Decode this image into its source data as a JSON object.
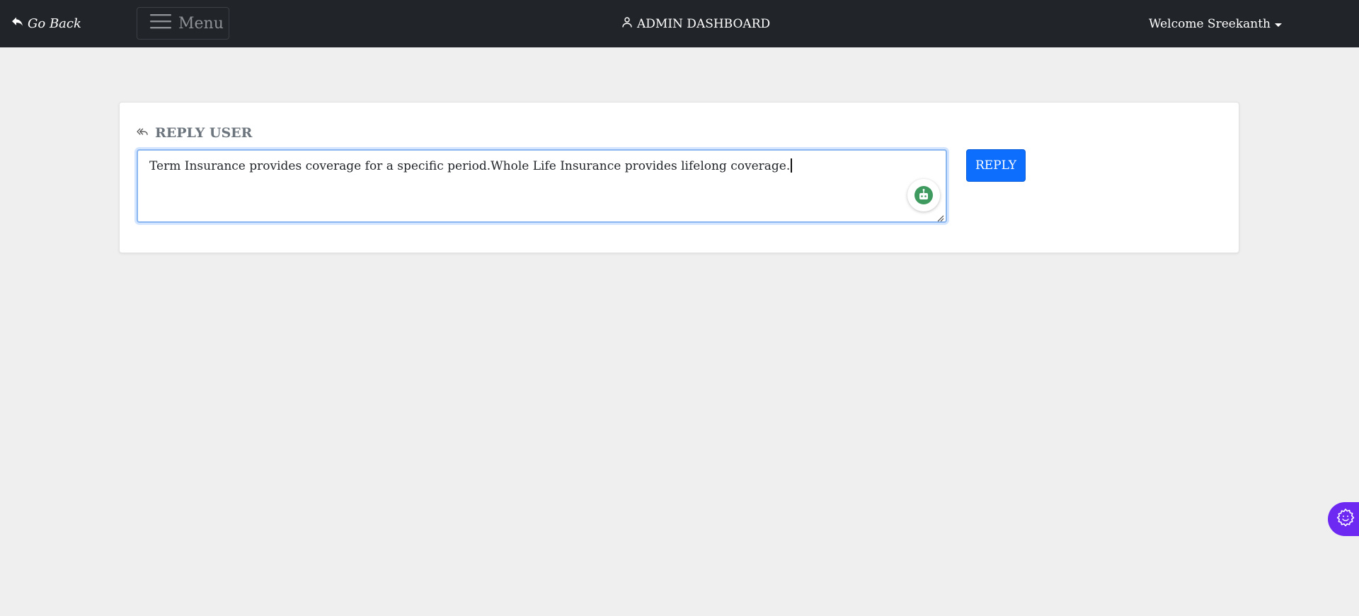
{
  "navbar": {
    "go_back_label": "Go Back",
    "menu_label": "Menu",
    "title": "ADMIN DASHBOARD",
    "welcome_label": "Welcome Sreekanth"
  },
  "reply_card": {
    "title": "REPLY USER",
    "textarea_value": "Term Insurance provides coverage for a specific period.Whole Life Insurance provides lifelong coverage.",
    "reply_button_label": "REPLY"
  },
  "colors": {
    "navbar_bg": "#212529",
    "page_bg": "#efefef",
    "primary_button": "#0d6efd",
    "widget_purple": "#6d28f2",
    "bot_green": "#3e9a5f"
  },
  "icons": {
    "go_back": "reply-arrow-icon",
    "menu": "hamburger-icon",
    "title": "user-icon",
    "welcome": "caret-down-icon",
    "card_title": "reply-all-icon",
    "textarea_helper": "robot-assistant-icon",
    "floating_widget": "gear-smile-icon"
  }
}
